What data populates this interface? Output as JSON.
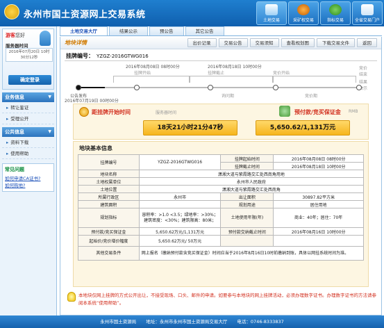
{
  "header": {
    "title": "永州市国土资源网上交易系统",
    "nav": [
      {
        "label": "土地交易",
        "icon": "land-trade-icon",
        "active": true
      },
      {
        "label": "采矿权交易",
        "icon": "mining-icon",
        "active": false
      },
      {
        "label": "指标交易",
        "icon": "globe-icon",
        "active": false
      },
      {
        "label": "全省交易门户",
        "icon": "portal-icon",
        "active": false
      }
    ]
  },
  "sidebar": {
    "welcome": "游客",
    "welcome_suffix": "您好",
    "server_time_label": "服务器时间",
    "server_time": "2016年07月20日 10时30分12秒",
    "login_button": "确定登录",
    "business": {
      "title": "业务信息",
      "items": [
        "转让鉴证",
        "受理公开"
      ]
    },
    "public": {
      "title": "公共信息",
      "items": [
        "资料下载",
        "使用帮助"
      ]
    },
    "faq": {
      "title": "常见问题",
      "links": [
        "如何申请CA证书?",
        "如何购地?"
      ]
    }
  },
  "tabs": [
    "土地交易大厅",
    "结果公示",
    "预公告",
    "其它公告"
  ],
  "subnav": {
    "section_title": "地块详情",
    "buttons": [
      "出价记录",
      "交易公告",
      "交易须知",
      "查看规划图",
      "下载交易文件",
      "返回"
    ]
  },
  "listing": {
    "label": "挂牌编号：",
    "number": "YZGZ-2016GTWG016"
  },
  "timeline": {
    "start_time": "2016年08月08日 08时00分",
    "start_label": "挂牌开始",
    "end_time": "2016年08月18日 10时00分",
    "end_label": "挂牌截止",
    "announce_label": "公告发布",
    "announce_time": "2016年07月19日 00时00分",
    "bid_label": "竞价开始",
    "inquiry_label": "询问期",
    "bidding_label": "竞价期",
    "result_end_label": "竞价结束",
    "result_label": "结果公示"
  },
  "countdown": {
    "start_label": "距挂牌开始时间",
    "start_sub": "服务器时间",
    "start_value": "18天21小时21分47秒",
    "deposit_label": "预付款/竞买保证金",
    "deposit_sub": "RMB",
    "deposit_value": "5,650.62/1,131万元"
  },
  "info": {
    "title": "地块基本信息",
    "rows": {
      "listing_no_k": "挂牌编号",
      "listing_no_v": "YZGZ-2016GTWG016",
      "start_k": "挂牌起始时间",
      "start_v": "2016年08月08日 08时00分",
      "end_k": "挂牌截止时间",
      "end_v": "2016年08月18日 10时00分",
      "name_k": "地块名称",
      "name_v": "潇湘大道与紫霞路交汇处西南角用地",
      "unit_k": "土地权属单位",
      "unit_v": "永州市人民政府",
      "loc_k": "土地位置",
      "loc_v": "潇湘大道与紫霞路交汇处西南角",
      "district_k": "所属行政区",
      "district_v": "永州市",
      "area_k": "出让面积",
      "area_v": "30897.82平方米",
      "buildarea_k": "建筑面积",
      "buildarea_v": "",
      "use_k": "规划用途",
      "use_v": "居住用地",
      "plan_k": "规划指标",
      "plan_v": "容积率：>1.0 <3.5；绿地率：>30%；建筑密度：<30%；建筑限高：80米；",
      "term_k": "土地使用年限(年)",
      "term_v": "商业：40年；居住：70年",
      "deposit_k": "预付款/竞买保证金",
      "deposit_v": "5,650.62万元/1,131万元",
      "deposit_deadline_k": "预付款交纳截止时间",
      "deposit_deadline_v": "2016年08月16日 10时00分",
      "startprice_k": "起始价/竞价增价幅度",
      "startprice_v": "5,650.62万元/ 50万元",
      "other_k": "其他交易条件",
      "other_v": "网上报名（缴纳预付款含竞买保证金）时间应当于2016年8月16日10时前缴纳到账，具体以网挂系统时间为准。"
    }
  },
  "notice": "本地块仅网上挂牌的方式公开出让，不接受现场、口头、邮件的申请。如要参与本地块的网上挂牌活动，必须办理数字证书。办理数字证书的方法请参阅本系统“使用帮助”。",
  "footer": {
    "org": "永州市国土资源局",
    "address": "地址：永州市永州市国土资源局交易大厅",
    "phone": "电话：0746-8333837"
  }
}
